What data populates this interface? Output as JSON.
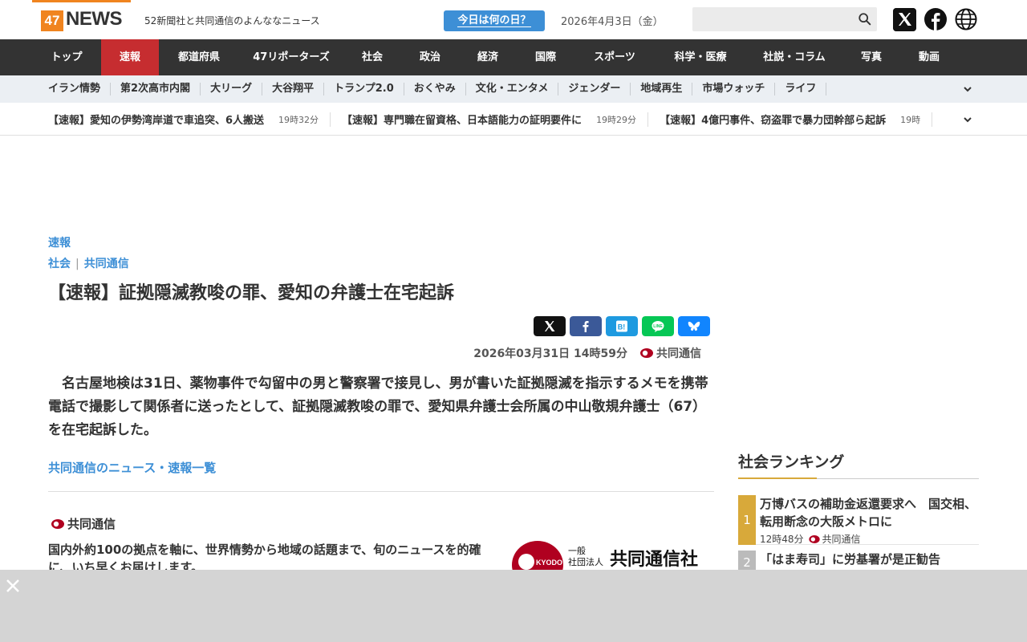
{
  "header": {
    "logo_num": "47",
    "logo_word": "NEWS",
    "tagline": "52新聞社と共同通信のよんななニュース",
    "today_button": "今日は何の日？",
    "date": "2026年4月3日（金）"
  },
  "mainnav": [
    {
      "label": "トップ",
      "w": 86
    },
    {
      "label": "速報",
      "w": 72,
      "active": true
    },
    {
      "label": "都道府県",
      "w": 100
    },
    {
      "label": "47リポーターズ",
      "w": 130
    },
    {
      "label": "社会",
      "w": 72
    },
    {
      "label": "政治",
      "w": 72
    },
    {
      "label": "経済",
      "w": 72
    },
    {
      "label": "国際",
      "w": 72
    },
    {
      "label": "スポーツ",
      "w": 100
    },
    {
      "label": "科学・医療",
      "w": 114
    },
    {
      "label": "社説・コラム",
      "w": 120
    },
    {
      "label": "写真",
      "w": 72
    },
    {
      "label": "動画",
      "w": 72
    }
  ],
  "subnav": [
    "イラン情勢",
    "第2次高市内閣",
    "大リーグ",
    "大谷翔平",
    "トランプ2.0",
    "おくやみ",
    "文化・エンタメ",
    "ジェンダー",
    "地域再生",
    "市場ウォッチ",
    "ライフ"
  ],
  "ticker": [
    {
      "title": "【速報】愛知の伊勢湾岸道で車追突、6人搬送",
      "time": "19時32分"
    },
    {
      "title": "【速報】専門職在留資格、日本語能力の証明要件に",
      "time": "19時29分"
    },
    {
      "title": "【速報】4億円事件、窃盗罪で暴力団幹部ら起訴",
      "time": "19時"
    }
  ],
  "article": {
    "kicker": "速報",
    "category": "社会",
    "source_link": "共同通信",
    "headline": "【速報】証拠隠滅教唆の罪、愛知の弁護士在宅起訴",
    "datetime": "2026年03月31日 14時59分",
    "source": "共同通信",
    "body": "　名古屋地検は31日、薬物事件で勾留中の男と警察署で接見し、男が書いた証拠隠滅を指示するメモを携帯電話で撮影して関係者に送ったとして、証拠隠滅教唆の罪で、愛知県弁護士会所属の中山敬規弁護士（67）を在宅起訴した。",
    "more_link": "共同通信のニュース・速報一覧",
    "src_name": "共同通信",
    "src_desc": "国内外約100の拠点を軸に、世界情勢から地域の話題まで、旬のニュースを的確に、いち早くお届けします。",
    "logo_small": "一般\n社団法人",
    "logo_big": "共同通信社",
    "logo_mark": "KYODO"
  },
  "sidebar": {
    "title": "社会ランキング",
    "items": [
      {
        "rank": "1",
        "title": "万博バスの補助金返還要求へ　国交相、転用断念の大阪メトロに",
        "time": "12時48分",
        "source": "共同通信"
      },
      {
        "rank": "2",
        "title": "「はま寿司」に労基署が是正勧告"
      }
    ]
  },
  "colors": {
    "brand_orange": "#f0841f",
    "accent_red": "#c62d30",
    "link_blue": "#3d8fd6",
    "rank_gold": "#d8a93a"
  }
}
